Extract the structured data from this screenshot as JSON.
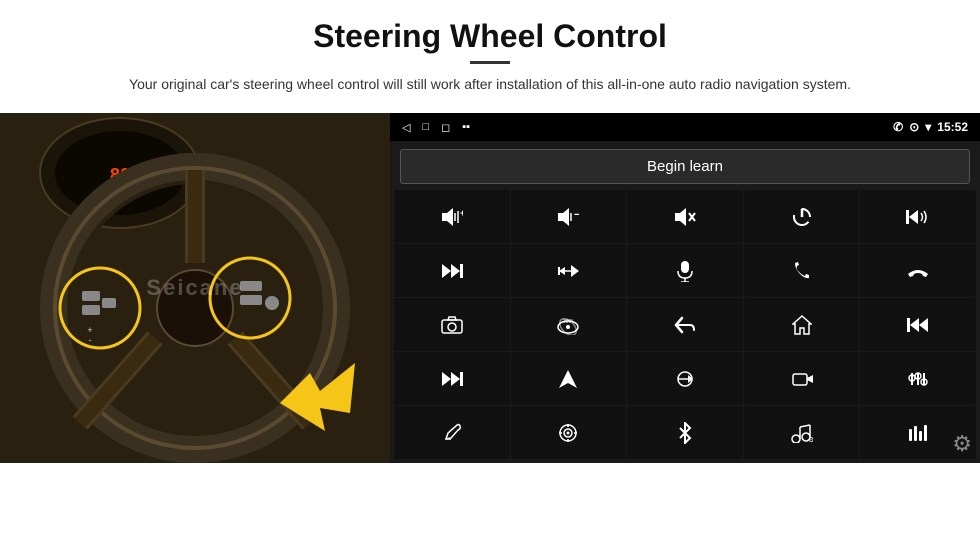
{
  "header": {
    "title": "Steering Wheel Control",
    "subtitle": "Your original car's steering wheel control will still work after installation of this all-in-one auto radio navigation system.",
    "divider_color": "#333"
  },
  "status_bar": {
    "back_icon": "◁",
    "home_icon": "□",
    "square_icon": "◻",
    "signal_icon": "▪▪",
    "phone_icon": "✆",
    "location_icon": "⊙",
    "wifi_icon": "▾",
    "time": "15:52"
  },
  "begin_learn": {
    "label": "Begin learn"
  },
  "buttons": [
    {
      "icon": "🔊+",
      "label": "vol-up"
    },
    {
      "icon": "🔊-",
      "label": "vol-down"
    },
    {
      "icon": "🔇",
      "label": "mute"
    },
    {
      "icon": "⏻",
      "label": "power"
    },
    {
      "icon": "⏮",
      "label": "prev-track-phone"
    },
    {
      "icon": "⏭",
      "label": "next"
    },
    {
      "icon": "⏩⏭",
      "label": "skip"
    },
    {
      "icon": "🎤",
      "label": "mic"
    },
    {
      "icon": "📞",
      "label": "call"
    },
    {
      "icon": "📵",
      "label": "end-call"
    },
    {
      "icon": "📷",
      "label": "camera"
    },
    {
      "icon": "360",
      "label": "360-view"
    },
    {
      "icon": "↩",
      "label": "back"
    },
    {
      "icon": "🏠",
      "label": "home"
    },
    {
      "icon": "⏮⏮",
      "label": "prev"
    },
    {
      "icon": "⏭",
      "label": "fast-forward"
    },
    {
      "icon": "⬆",
      "label": "navigate"
    },
    {
      "icon": "⇄",
      "label": "source"
    },
    {
      "icon": "📷",
      "label": "camera2"
    },
    {
      "icon": "⚙",
      "label": "settings"
    },
    {
      "icon": "✏",
      "label": "edit"
    },
    {
      "icon": "🎯",
      "label": "target"
    },
    {
      "icon": "✱",
      "label": "bluetooth"
    },
    {
      "icon": "🎵",
      "label": "music"
    },
    {
      "icon": "📊",
      "label": "equalizer"
    }
  ],
  "watermark": "Seicane",
  "gear_icon": "⚙"
}
